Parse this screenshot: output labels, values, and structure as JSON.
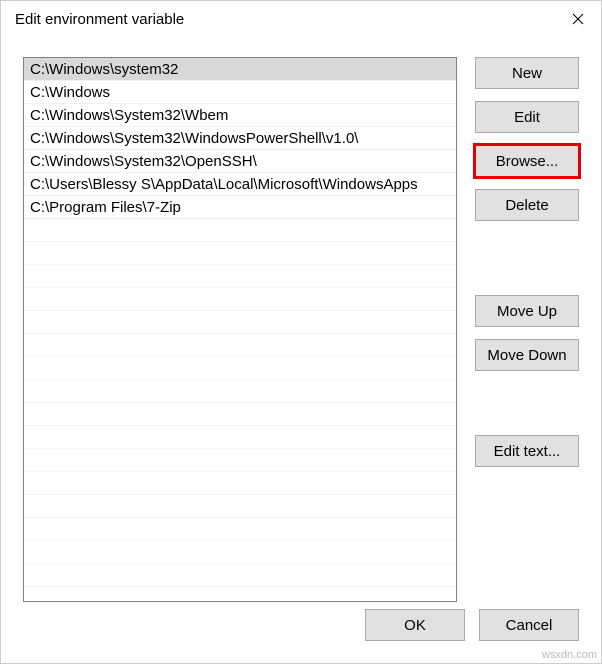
{
  "window": {
    "title": "Edit environment variable"
  },
  "list": {
    "items": [
      "C:\\Windows\\system32",
      "C:\\Windows",
      "C:\\Windows\\System32\\Wbem",
      "C:\\Windows\\System32\\WindowsPowerShell\\v1.0\\",
      "C:\\Windows\\System32\\OpenSSH\\",
      "C:\\Users\\Blessy S\\AppData\\Local\\Microsoft\\WindowsApps",
      "C:\\Program Files\\7-Zip"
    ],
    "selected_index": 0
  },
  "buttons": {
    "new": "New",
    "edit": "Edit",
    "browse": "Browse...",
    "delete": "Delete",
    "move_up": "Move Up",
    "move_down": "Move Down",
    "edit_text": "Edit text...",
    "ok": "OK",
    "cancel": "Cancel"
  },
  "highlight": "browse",
  "watermark": "wsxdn.com"
}
